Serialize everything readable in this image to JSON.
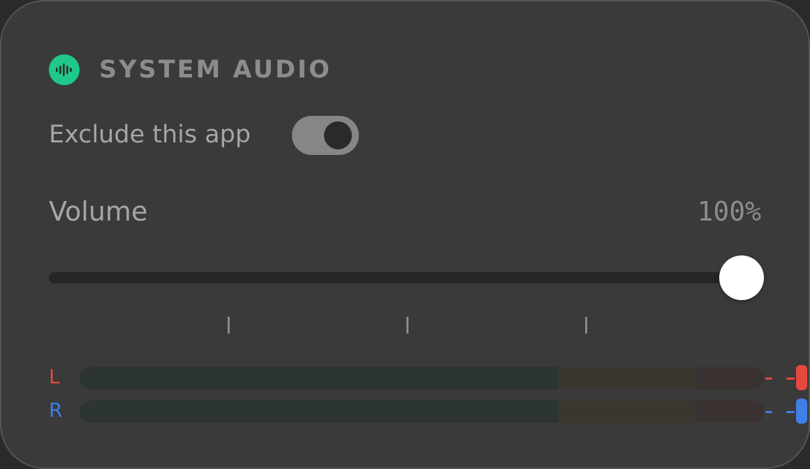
{
  "panel": {
    "title": "SYSTEM AUDIO",
    "icon": "audio-waveform-icon",
    "accent_color": "#1fc98a"
  },
  "exclude": {
    "label": "Exclude this app",
    "enabled": true
  },
  "volume": {
    "label": "Volume",
    "value_text": "100%",
    "level": 1.0
  },
  "meters": [
    {
      "channel": "L",
      "color": "#e5483f",
      "peak_icon": "peak-indicator-icon"
    },
    {
      "channel": "R",
      "color": "#3f7fe8",
      "peak_icon": "peak-indicator-icon"
    }
  ]
}
